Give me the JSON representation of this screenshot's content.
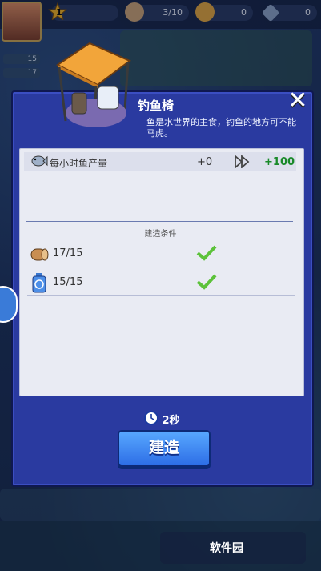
{
  "topbar": {
    "level": "1",
    "people": "3/10",
    "coins": "0",
    "gems": "0"
  },
  "side": {
    "value1": "15",
    "value2": "17"
  },
  "dialog": {
    "title": "钓鱼椅",
    "description": "鱼是水世界的主食，钓鱼的地方可不能马虎。",
    "stat_label": "每小时鱼产量",
    "stat_current": "+0",
    "stat_next": "+100",
    "conditions_header": "建造条件",
    "conditions": [
      {
        "icon": "wood-log-icon",
        "value": "17/15"
      },
      {
        "icon": "recycle-bottle-icon",
        "value": "15/15"
      }
    ],
    "time": "2秒",
    "build_label": "建造",
    "close_label": "✕"
  },
  "watermark": {
    "text": "软件园"
  },
  "colors": {
    "dialog": "#2a3aa0",
    "button": "#3a86f0",
    "positive": "#1a8a2a"
  }
}
